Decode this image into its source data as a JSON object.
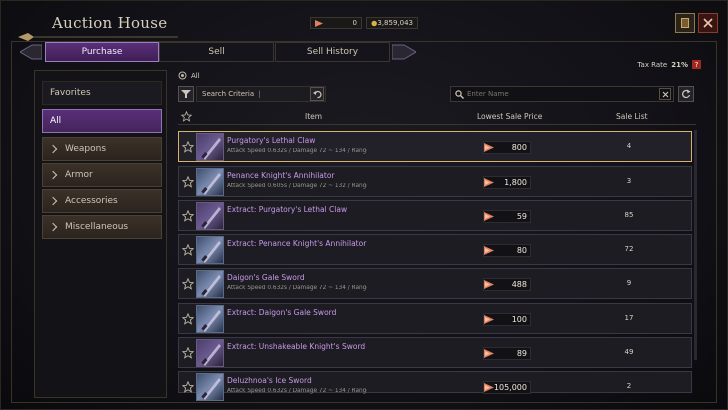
{
  "window": {
    "title": "Auction House"
  },
  "currency": {
    "premium_value": "0",
    "gold_value": "3,859,043"
  },
  "tabs": [
    {
      "label": "Purchase"
    },
    {
      "label": "Sell"
    },
    {
      "label": "Sell History"
    }
  ],
  "tax": {
    "label": "Tax Rate",
    "value": "21%",
    "help": "?"
  },
  "sidebar": {
    "favorites": "Favorites",
    "all": "All",
    "categories": [
      {
        "label": "Weapons"
      },
      {
        "label": "Armor"
      },
      {
        "label": "Accessories"
      },
      {
        "label": "Miscellaneous"
      }
    ]
  },
  "crumb": {
    "label": "All"
  },
  "search": {
    "criteria_placeholder": "Search Criteria",
    "name_placeholder": "Enter Name"
  },
  "columns": {
    "item": "Item",
    "price": "Lowest Sale Price",
    "list": "Sale List"
  },
  "items": [
    {
      "name": "Purgatory's Lethal Claw",
      "stats": "Attack Speed 0.632s / Damage 72 ~ 134 / Range 2.",
      "price": "800",
      "count": "4",
      "thumb": "purple"
    },
    {
      "name": "Penance Knight's Annihilator",
      "stats": "Attack Speed 0.605s / Damage 72 ~ 132 / Range 2.",
      "price": "1,800",
      "count": "3",
      "thumb": "gray"
    },
    {
      "name": "Extract: Purgatory's Lethal Claw",
      "stats": "",
      "price": "59",
      "count": "85",
      "thumb": "purple"
    },
    {
      "name": "Extract: Penance Knight's Annihilator",
      "stats": "",
      "price": "80",
      "count": "72",
      "thumb": "gray"
    },
    {
      "name": "Daigon's Gale Sword",
      "stats": "Attack Speed 0.632s / Damage 72 ~ 134 / Range 2.",
      "price": "488",
      "count": "9",
      "thumb": "gray"
    },
    {
      "name": "Extract: Daigon's Gale Sword",
      "stats": "",
      "price": "100",
      "count": "17",
      "thumb": "gray"
    },
    {
      "name": "Extract: Unshakeable Knight's Sword",
      "stats": "",
      "price": "89",
      "count": "49",
      "thumb": "purple"
    },
    {
      "name": "Deluzhnoa's Ice Sword",
      "stats": "Attack Speed 0.632s / Damage 72 ~ 134 / Range 2.",
      "price": "105,000",
      "count": "2",
      "thumb": "gray"
    }
  ],
  "colors": {
    "accent_purple": "#5a2f78",
    "selection_gold": "#d5b36a",
    "item_name": "#c89ae8"
  }
}
